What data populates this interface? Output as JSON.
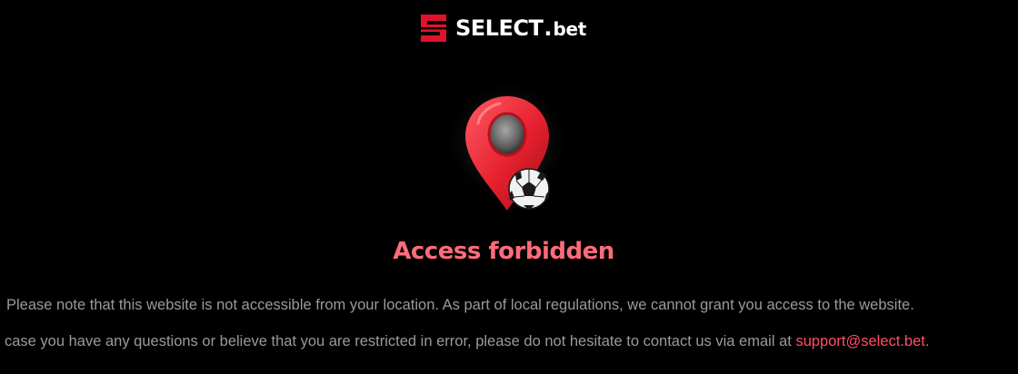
{
  "brand": {
    "name": "SELECT",
    "dot": ".",
    "suffix": "bet",
    "accent_color": "#e3122b"
  },
  "hero": {
    "icons": [
      "location-pin-icon",
      "soccer-ball-icon"
    ]
  },
  "main": {
    "title": "Access forbidden",
    "message_line1": "Please note that this website is not accessible from your location. As part of local regulations, we cannot grant you access to the website.",
    "message_line2": "case you have any questions or believe that you are restricted in error, please do not hesitate to contact us via email at",
    "email": "support@select.bet."
  },
  "colors": {
    "background": "#000000",
    "title": "#ff6b7a",
    "text": "#9a9a9a",
    "link": "#ff4d6a"
  }
}
